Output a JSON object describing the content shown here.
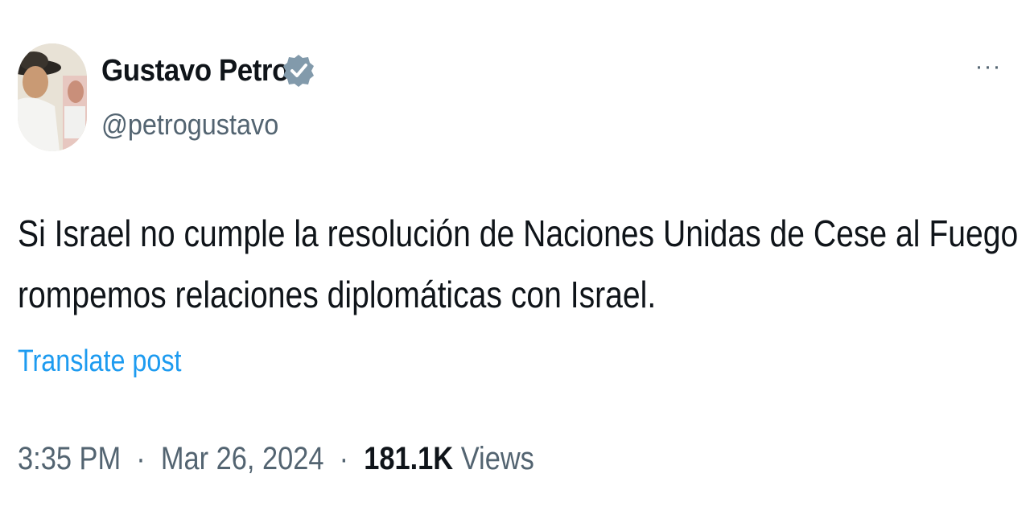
{
  "author": {
    "display_name": "Gustavo Petro",
    "handle": "@petrogustavo",
    "verified": true,
    "verified_color": "#829aab"
  },
  "menu": {
    "more_icon": "more-horizontal-icon",
    "more_glyph": "···"
  },
  "post": {
    "lines": [
      "Si Israel no cumple la resolución de Naciones Unidas de Cese al Fuego",
      "rompemos relaciones diplomáticas con Israel."
    ],
    "translate_label": "Translate post"
  },
  "meta": {
    "time": "3:35 PM",
    "separator": "·",
    "date": "Mar 26, 2024",
    "views_count": "181.1K",
    "views_label": "Views"
  },
  "colors": {
    "text": "#0f1419",
    "secondary": "#536471",
    "link": "#1d9bf0"
  }
}
